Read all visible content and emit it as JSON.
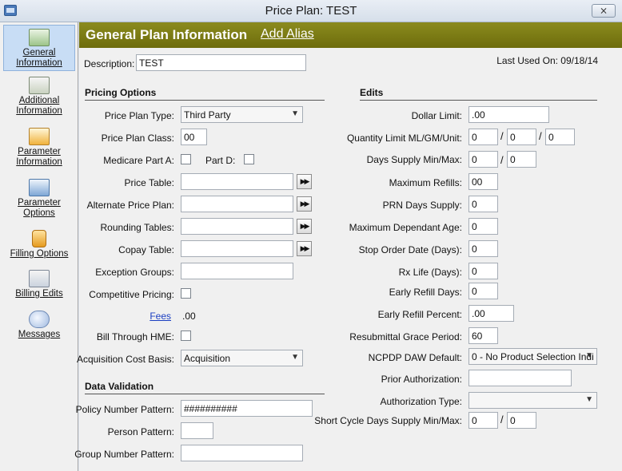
{
  "window": {
    "title": "Price Plan: TEST",
    "close_glyph": "⨯"
  },
  "sidebar": {
    "items": [
      {
        "label": "General Information",
        "icon": "general-information-icon"
      },
      {
        "label": "Additional Information",
        "icon": "additional-information-icon"
      },
      {
        "label": "Parameter Information",
        "icon": "parameter-information-icon"
      },
      {
        "label": "Parameter Options",
        "icon": "parameter-options-icon"
      },
      {
        "label": "Filling Options",
        "icon": "filling-options-icon"
      },
      {
        "label": "Billing Edits",
        "icon": "billing-edits-icon"
      },
      {
        "label": "Messages",
        "icon": "messages-icon"
      }
    ]
  },
  "header": {
    "title": "General Plan Information",
    "add_alias": "Add Alias"
  },
  "description": {
    "label": "Description:",
    "value": "TEST"
  },
  "last_used": "Last Used On: 09/18/14",
  "pricing": {
    "section": "Pricing Options",
    "plan_type_label": "Price Plan Type:",
    "plan_type_value": "Third Party",
    "plan_class_label": "Price Plan Class:",
    "plan_class_value": "00",
    "medicare_a_label": "Medicare Part A:",
    "part_d_label": "Part D:",
    "price_table_label": "Price Table:",
    "alt_plan_label": "Alternate Price Plan:",
    "rounding_label": "Rounding Tables:",
    "copay_label": "Copay Table:",
    "exception_label": "Exception Groups:",
    "competitive_label": "Competitive Pricing:",
    "fees_label": "Fees",
    "fees_value": ".00",
    "hme_label": "Bill Through HME:",
    "acq_label": "Acquisition Cost Basis:",
    "acq_value": "Acquisition"
  },
  "validation": {
    "section": "Data Validation",
    "policy_label": "Policy Number Pattern:",
    "policy_value": "##########",
    "person_label": "Person Pattern:",
    "group_label": "Group Number Pattern:"
  },
  "edits": {
    "section": "Edits",
    "dollar_label": "Dollar Limit:",
    "dollar_value": ".00",
    "qty_label": "Quantity Limit ML/GM/Unit:",
    "qty_ml": "0",
    "qty_gm": "0",
    "qty_unit": "0",
    "days_label": "Days Supply Min/Max:",
    "days_min": "0",
    "days_max": "0",
    "refills_label": "Maximum Refills:",
    "refills_value": "00",
    "prn_label": "PRN Days Supply:",
    "prn_value": "0",
    "dep_age_label": "Maximum Dependant Age:",
    "dep_age_value": "0",
    "stop_label": "Stop Order Date (Days):",
    "stop_value": "0",
    "rxlife_label": "Rx Life (Days):",
    "rxlife_value": "0",
    "early_days_label": "Early Refill Days:",
    "early_days_value": "0",
    "early_pct_label": "Early Refill Percent:",
    "early_pct_value": ".00",
    "grace_label": "Resubmittal Grace Period:",
    "grace_value": "60",
    "daw_label": "NCPDP DAW Default:",
    "daw_value": "0 - No Product Selection Indi",
    "prior_label": "Prior Authorization:",
    "auth_type_label": "Authorization Type:",
    "short_label": "Short Cycle Days Supply Min/Max:",
    "short_min": "0",
    "short_max": "0"
  },
  "colors": {
    "banner": "#7a7915",
    "active_nav": "#c8ddf5",
    "link": "#1a3ec1"
  }
}
